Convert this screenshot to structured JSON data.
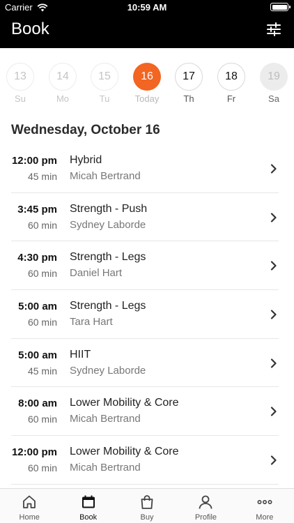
{
  "status_bar": {
    "carrier": "Carrier",
    "time": "10:59 AM"
  },
  "header": {
    "title": "Book"
  },
  "date_strip": [
    {
      "num": "13",
      "label": "Su",
      "state": "past"
    },
    {
      "num": "14",
      "label": "Mo",
      "state": "past"
    },
    {
      "num": "15",
      "label": "Tu",
      "state": "past"
    },
    {
      "num": "16",
      "label": "Today",
      "state": "today"
    },
    {
      "num": "17",
      "label": "Th",
      "state": "future"
    },
    {
      "num": "18",
      "label": "Fr",
      "state": "future"
    },
    {
      "num": "19",
      "label": "Sa",
      "state": "dim"
    }
  ],
  "date_heading": "Wednesday, October 16",
  "classes": [
    {
      "time": "12:00 pm",
      "duration": "45 min",
      "name": "Hybrid",
      "instructor": "Micah Bertrand"
    },
    {
      "time": "3:45 pm",
      "duration": "60 min",
      "name": "Strength - Push",
      "instructor": "Sydney Laborde"
    },
    {
      "time": "4:30 pm",
      "duration": "60 min",
      "name": "Strength - Legs",
      "instructor": "Daniel Hart"
    },
    {
      "time": "5:00 am",
      "duration": "60 min",
      "name": "Strength - Legs",
      "instructor": "Tara Hart"
    },
    {
      "time": "5:00 am",
      "duration": "45 min",
      "name": "HIIT",
      "instructor": "Sydney Laborde"
    },
    {
      "time": "8:00 am",
      "duration": "60 min",
      "name": "Lower Mobility & Core",
      "instructor": "Micah Bertrand"
    },
    {
      "time": "12:00 pm",
      "duration": "60 min",
      "name": "Lower Mobility & Core",
      "instructor": "Micah Bertrand"
    }
  ],
  "tabs": [
    {
      "label": "Home",
      "icon": "home-icon"
    },
    {
      "label": "Book",
      "icon": "calendar-icon",
      "active": true
    },
    {
      "label": "Buy",
      "icon": "shopping-bag-icon"
    },
    {
      "label": "Profile",
      "icon": "profile-icon"
    },
    {
      "label": "More",
      "icon": "more-icon"
    }
  ],
  "colors": {
    "accent": "#f26522",
    "header_bg": "#000000"
  }
}
